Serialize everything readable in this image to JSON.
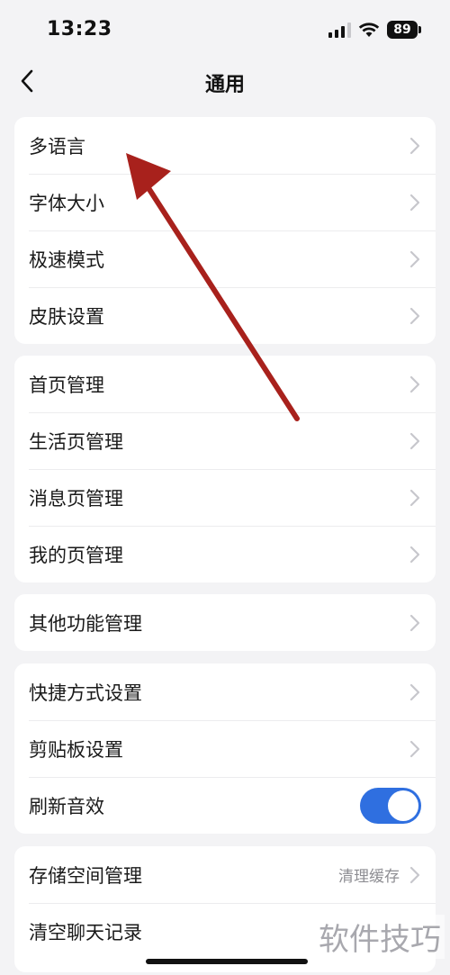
{
  "status_bar": {
    "time": "13:23",
    "battery": "89"
  },
  "nav": {
    "title": "通用"
  },
  "groups": [
    {
      "items": [
        {
          "label": "多语言"
        },
        {
          "label": "字体大小"
        },
        {
          "label": "极速模式"
        },
        {
          "label": "皮肤设置"
        }
      ]
    },
    {
      "items": [
        {
          "label": "首页管理"
        },
        {
          "label": "生活页管理"
        },
        {
          "label": "消息页管理"
        },
        {
          "label": "我的页管理"
        }
      ]
    },
    {
      "items": [
        {
          "label": "其他功能管理"
        }
      ]
    },
    {
      "items": [
        {
          "label": "快捷方式设置"
        },
        {
          "label": "剪贴板设置"
        },
        {
          "label": "刷新音效",
          "toggle_on": true
        }
      ]
    },
    {
      "items": [
        {
          "label": "存储空间管理",
          "value": "清理缓存"
        },
        {
          "label": "清空聊天记录"
        }
      ]
    }
  ],
  "watermark": "软件技巧",
  "colors": {
    "accent": "#2f6fe0",
    "annotation_arrow": "#a8211c",
    "background": "#f3f3f5"
  }
}
